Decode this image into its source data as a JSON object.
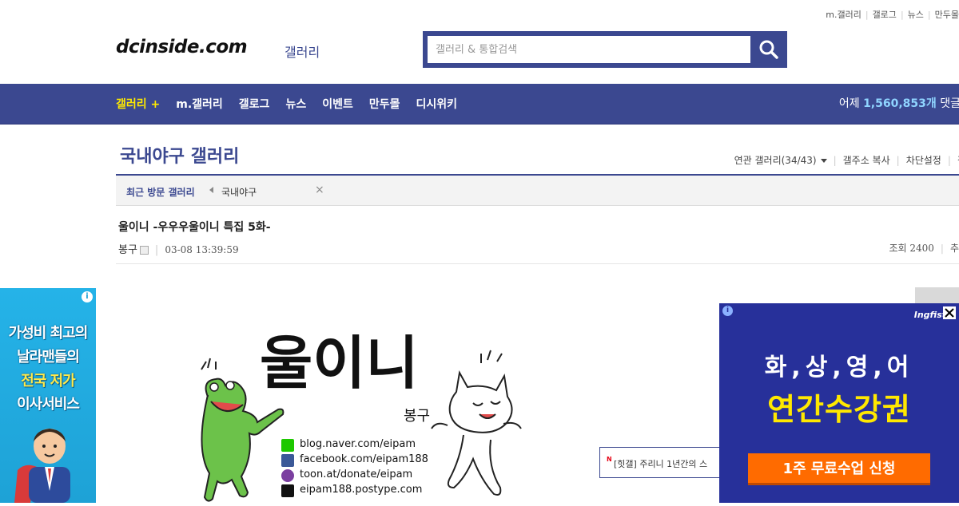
{
  "util_links": [
    "m.갤러리",
    "갤로그",
    "뉴스",
    "만두몰"
  ],
  "header": {
    "logo": "dcinside.com",
    "logo_sub": "갤러리",
    "search_placeholder": "갤러리 & 통합검색"
  },
  "nav": {
    "items": [
      "갤러리 +",
      "m.갤러리",
      "갤로그",
      "뉴스",
      "이벤트",
      "만두몰",
      "디시위키"
    ],
    "stats_prefix": "어제",
    "stats_count": "1,560,853개",
    "stats_suffix": "댓글"
  },
  "gallery": {
    "title": "국내야구 갤러리",
    "related": "연관 갤러리(34/43)",
    "copy_url": "갤주소 복사",
    "block": "차단설정",
    "more": "갤러"
  },
  "recent": {
    "label": "최근 방문 갤러리",
    "item": "국내야구"
  },
  "post": {
    "title": "울이니 -우우우울이니 특집 5화-",
    "author": "봉구",
    "date": "03-08 13:39:59",
    "views": "조회 2400",
    "recommend": "추"
  },
  "content": {
    "comic_title": "울이니",
    "comic_author": "봉구",
    "links": [
      {
        "icon": "blog-icon",
        "text": "blog.naver.com/eipam",
        "color": "#1ec800"
      },
      {
        "icon": "facebook-icon",
        "text": "facebook.com/eipam188",
        "color": "#3b5998"
      },
      {
        "icon": "toon-icon",
        "text": "toon.at/donate/eipam",
        "color": "#7b3fa0"
      },
      {
        "icon": "postype-icon",
        "text": "eipam188.postype.com",
        "color": "#111111"
      }
    ]
  },
  "left_ad": {
    "lines": [
      "가성비 최고의",
      "날라맨들의",
      "전국 저가",
      "이사서비스"
    ]
  },
  "right_ad": {
    "brand": "Ingfist",
    "headline1": "화,상,영,어",
    "headline2": "연간수강권",
    "cta": "1주 무료수업 신청"
  },
  "news_popup": {
    "badge": "N",
    "text": "[힛갤] 주리니 1년간의 스"
  },
  "colors": {
    "brand": "#3b4890",
    "nav_highlight": "#ffea00",
    "stats_count": "#8fd4ff"
  }
}
